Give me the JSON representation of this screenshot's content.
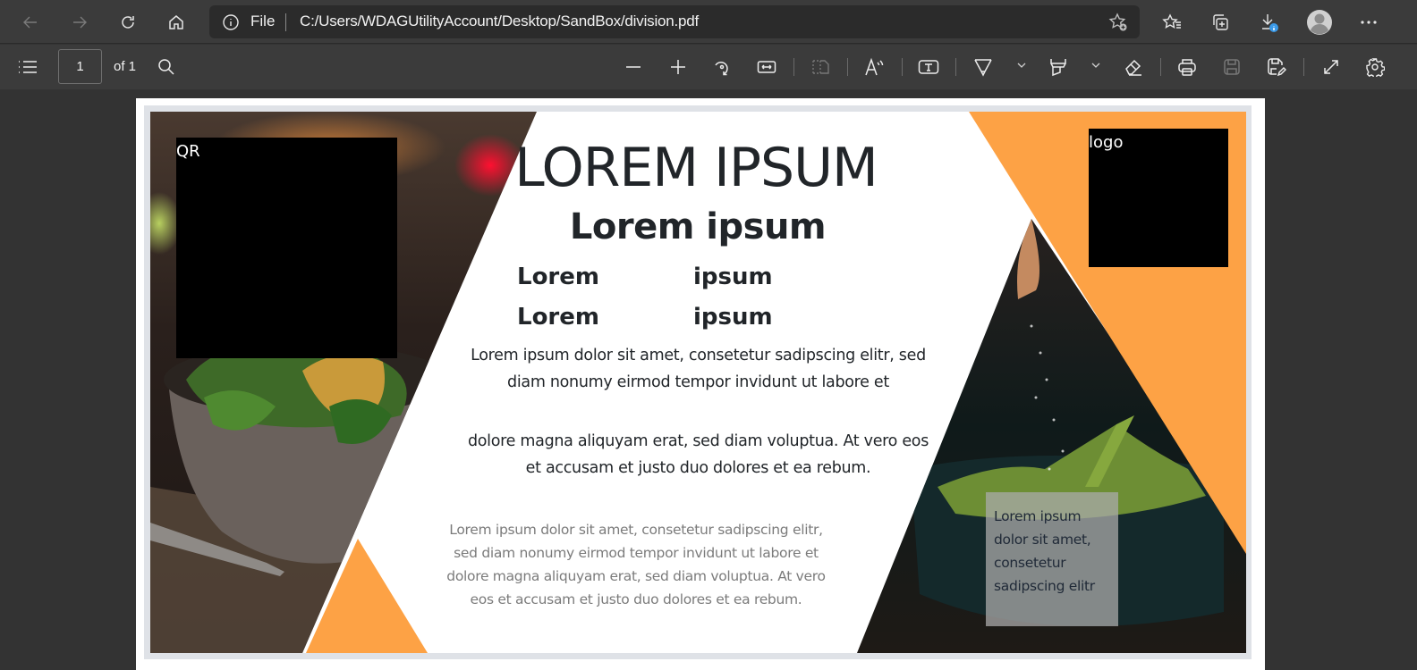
{
  "browser": {
    "address": {
      "scheme_label": "File",
      "url": "C:/Users/WDAGUtilityAccount/Desktop/SandBox/division.pdf"
    },
    "nav": [
      "back-icon",
      "forward-icon",
      "refresh-icon",
      "home-icon"
    ],
    "right_icons": [
      "add-favorite-icon",
      "favorites-icon",
      "collections-icon",
      "downloads-icon",
      "profile-avatar",
      "more-icon"
    ]
  },
  "pdf_toolbar": {
    "current_page": "1",
    "page_count_label": "of 1",
    "tools": [
      "contents-icon",
      "search-icon",
      "zoom-out-icon",
      "zoom-in-icon",
      "rotate-icon",
      "fit-width-icon",
      "page-view-icon",
      "read-aloud-icon",
      "text-box-icon",
      "draw-icon",
      "highlight-icon",
      "erase-icon",
      "print-icon",
      "save-icon",
      "save-as-icon",
      "fullscreen-icon",
      "settings-icon"
    ]
  },
  "document": {
    "qr_label": "QR",
    "logo_label": "logo",
    "title": "LOREM IPSUM",
    "subtitle": "Lorem ipsum",
    "grid": [
      [
        "Lorem",
        "ipsum"
      ],
      [
        "Lorem",
        "ipsum"
      ]
    ],
    "paragraph1": "Lorem ipsum dolor sit amet, consetetur sadipscing elitr, sed diam nonumy eirmod tempor invidunt ut labore et",
    "paragraph2": "dolore magna aliquyam erat, sed diam voluptua. At vero eos et accusam et justo duo dolores et ea rebum.",
    "paragraph_muted": "Lorem ipsum dolor sit amet, consetetur sadipscing elitr, sed diam nonumy eirmod tempor invidunt ut labore et dolore magna aliquyam erat, sed diam voluptua. At vero eos et accusam et justo duo dolores et ea rebum.",
    "caption": "Lorem ipsum dolor sit amet, consetetur sadipscing elitr",
    "accent_color": "#FDA245"
  }
}
